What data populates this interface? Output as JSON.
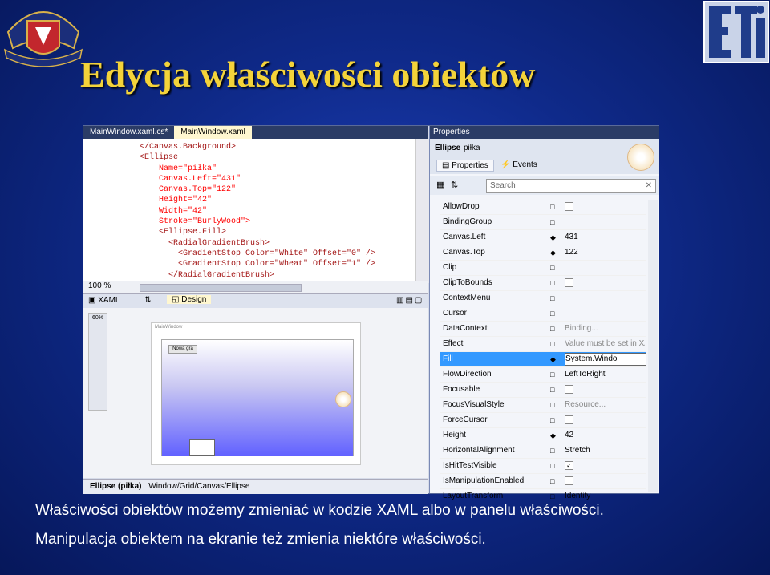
{
  "slide": {
    "title": "Edycja właściwości obiektów",
    "line1": "Właściwości obiektów możemy zmieniać w kodzie XAML albo w panelu właściwości.",
    "line2": "Manipulacja obiektem na ekranie też zmienia niektóre właściwości."
  },
  "logos": {
    "left": "PG crest",
    "right": "ETI"
  },
  "editor": {
    "tabs": [
      "MainWindow.xaml.cs*",
      "MainWindow.xaml"
    ],
    "code": [
      "</Canvas.Background>",
      "<Ellipse",
      "    Name=\"piłka\"",
      "    Canvas.Left=\"431\"",
      "    Canvas.Top=\"122\"",
      "    Height=\"42\"",
      "    Width=\"42\"",
      "    Stroke=\"BurlyWood\">",
      "    <Ellipse.Fill>",
      "      <RadialGradientBrush>",
      "        <GradientStop Color=\"White\" Offset=\"0\" />",
      "        <GradientStop Color=\"Wheat\" Offset=\"1\" />",
      "      </RadialGradientBrush>"
    ],
    "zoom": "100 %",
    "split": {
      "xaml_tab": "XAML",
      "swap": "⇅",
      "design_tab": "Design"
    },
    "designer": {
      "zoom_label": "60%",
      "window_title": "MainWindow",
      "button": "Nowa gra"
    },
    "status": {
      "element": "Ellipse (piłka)",
      "path": "Window/Grid/Canvas/Ellipse"
    }
  },
  "properties": {
    "header": "Properties",
    "element_type": "Ellipse",
    "element_name": "piłka",
    "tabs": [
      "Properties",
      "Events"
    ],
    "search_placeholder": "Search",
    "rows": [
      {
        "name": "AllowDrop",
        "mark": "□",
        "value": "",
        "check": "empty"
      },
      {
        "name": "BindingGroup",
        "mark": "□",
        "value": ""
      },
      {
        "name": "Canvas.Left",
        "mark": "◆",
        "value": "431"
      },
      {
        "name": "Canvas.Top",
        "mark": "◆",
        "value": "122"
      },
      {
        "name": "Clip",
        "mark": "□",
        "value": ""
      },
      {
        "name": "ClipToBounds",
        "mark": "□",
        "value": "",
        "check": "empty"
      },
      {
        "name": "ContextMenu",
        "mark": "□",
        "value": ""
      },
      {
        "name": "Cursor",
        "mark": "□",
        "value": ""
      },
      {
        "name": "DataContext",
        "mark": "□",
        "value": "Binding..."
      },
      {
        "name": "Effect",
        "mark": "□",
        "value": "Value must be set in XA"
      },
      {
        "name": "Fill",
        "mark": "◆",
        "value": "System.Windo",
        "selected": true
      },
      {
        "name": "FlowDirection",
        "mark": "□",
        "value": "LeftToRight"
      },
      {
        "name": "Focusable",
        "mark": "□",
        "value": "",
        "check": "empty"
      },
      {
        "name": "FocusVisualStyle",
        "mark": "□",
        "value": "Resource..."
      },
      {
        "name": "ForceCursor",
        "mark": "□",
        "value": "",
        "check": "empty"
      },
      {
        "name": "Height",
        "mark": "◆",
        "value": "42"
      },
      {
        "name": "HorizontalAlignment",
        "mark": "□",
        "value": "Stretch"
      },
      {
        "name": "IsHitTestVisible",
        "mark": "□",
        "value": "",
        "check": "checked"
      },
      {
        "name": "IsManipulationEnabled",
        "mark": "□",
        "value": "",
        "check": "empty"
      },
      {
        "name": "LayoutTransform",
        "mark": "□",
        "value": "Identity"
      }
    ]
  }
}
